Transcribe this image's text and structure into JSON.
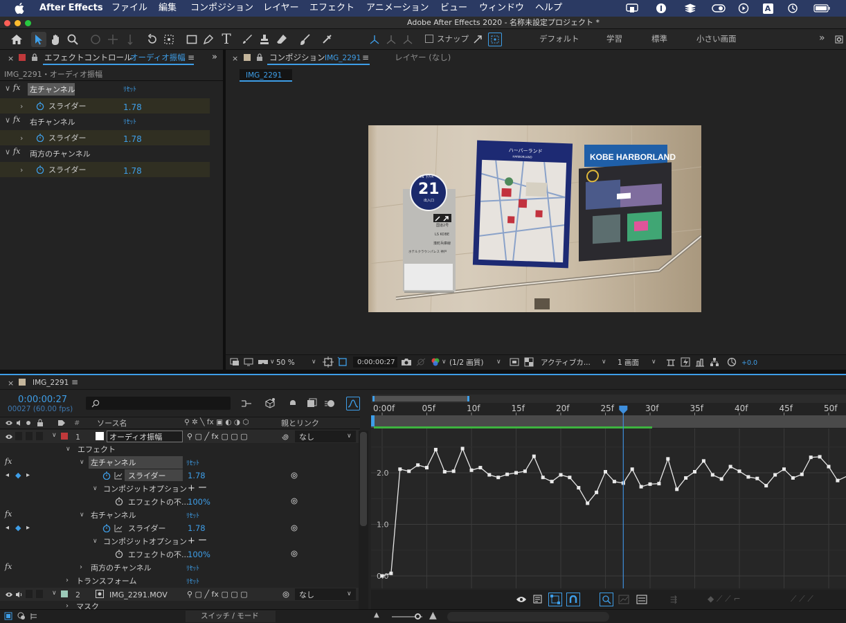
{
  "menubar": {
    "apple": "",
    "app": "After Effects",
    "items": [
      "ファイル",
      "編集",
      "コンポジション",
      "レイヤー",
      "エフェクト",
      "アニメーション",
      "ビュー",
      "ウィンドウ",
      "ヘルプ"
    ],
    "status_letter": "A"
  },
  "window": {
    "title": "Adobe After Effects 2020 - 名称未設定プロジェクト *"
  },
  "toolbar": {
    "snap_label": "スナップ",
    "workspaces": [
      "デフォルト",
      "学習",
      "標準",
      "小さい画面"
    ],
    "more": "»"
  },
  "effects_panel": {
    "tab_label": "エフェクトコントロール",
    "tab_target": "オーディオ振幅",
    "breadcrumb": "IMG_2291・オーディオ振幅",
    "fx": "fx",
    "reset": "ﾘｾｯﾄ",
    "effects": [
      {
        "name": "左チャンネル",
        "param": "スライダー",
        "value": "1.78"
      },
      {
        "name": "右チャンネル",
        "param": "スライダー",
        "value": "1.78"
      },
      {
        "name": "両方のチャンネル",
        "param": "スライダー",
        "value": "1.78"
      }
    ]
  },
  "comp_panel": {
    "tab_label": "コンポジション",
    "tab_target": "IMG_2291",
    "layer_tab": "レイヤー (なし)",
    "subtab": "IMG_2291",
    "viewer": {
      "sign_badge_top": "IN 下ﾁｬｷﾞ",
      "sign_badge_num": "21",
      "sign_badge_sub": "出入口",
      "sign_lines": [
        "国道2号",
        "LS KOBE",
        "湊町兵庫線",
        "ホテルクラウンパレス 神戸"
      ],
      "map_title": "ハーバーランド",
      "map_subtitle": "HARBORLAND",
      "board_title": "KOBE HARBORLAND"
    },
    "bottom": {
      "zoom": "50 %",
      "timecode": "0:00:00:27",
      "resolution": "(1/2 画質)",
      "camera": "アクティブカ...",
      "views": "1 画面",
      "exposure": "+0.0"
    }
  },
  "timeline": {
    "tab": "IMG_2291",
    "timecode": "0:00:00:27",
    "frames": "00027 (60.00 fps)",
    "search_placeholder": "",
    "col_hash": "#",
    "col_source": "ソース名",
    "col_parent": "親とリンク",
    "layers": [
      {
        "index": "1",
        "name": "オーディオ振幅",
        "parent": "なし",
        "label_color": "#c0393b"
      },
      {
        "index": "2",
        "name": "IMG_2291.MOV",
        "parent": "なし",
        "label_color": "#9ccab9"
      }
    ],
    "tree": {
      "effects": "エフェクト",
      "left": "左チャンネル",
      "right": "右チャンネル",
      "both": "両方のチャンネル",
      "transform": "トランスフォーム",
      "mask": "マスク",
      "slider": "スライダー",
      "slider_value": "1.78",
      "composite": "コンポジットオプション",
      "opacity": "エフェクトの不...",
      "opacity_value": "100%",
      "plusminus": "+ ー",
      "reset": "ﾘｾｯﾄ"
    },
    "ruler": [
      "0:00f",
      "05f",
      "10f",
      "15f",
      "20f",
      "25f",
      "30f",
      "35f",
      "40f",
      "45f",
      "50f"
    ],
    "graph_y_labels": [
      "2.0",
      "1.0",
      "0.0"
    ],
    "switch_mode": "スイッチ / モード"
  },
  "chart_data": {
    "type": "line",
    "title": "",
    "xlabel": "",
    "ylabel": "",
    "xlim": [
      0,
      52
    ],
    "ylim": [
      0,
      3
    ],
    "series": [
      {
        "name": "",
        "x": [
          0,
          1,
          2,
          3,
          4,
          5,
          6,
          7,
          8,
          9,
          10,
          11,
          12,
          13,
          14,
          15,
          16,
          17,
          18,
          19,
          20,
          21,
          22,
          23,
          24,
          25,
          26,
          27,
          28,
          29,
          30,
          31,
          32,
          33,
          34,
          35,
          36,
          37,
          38,
          39,
          40,
          41,
          42,
          43,
          44,
          45,
          46,
          47,
          48,
          49,
          50,
          51,
          52
        ],
        "y": [
          0.0,
          0.05,
          2.07,
          2.03,
          2.15,
          2.1,
          2.45,
          2.02,
          2.03,
          2.47,
          2.05,
          2.1,
          1.96,
          1.91,
          1.97,
          2.0,
          2.03,
          2.32,
          1.91,
          1.83,
          1.96,
          1.91,
          1.71,
          1.41,
          1.62,
          2.02,
          1.83,
          1.8,
          2.07,
          1.73,
          1.78,
          1.79,
          2.27,
          1.68,
          1.9,
          2.02,
          2.23,
          1.96,
          1.88,
          2.12,
          2.03,
          1.92,
          1.89,
          1.75,
          1.96,
          2.07,
          1.9,
          1.97,
          2.3,
          2.31,
          2.12,
          1.85,
          1.93
        ]
      }
    ],
    "current_frame": 27
  },
  "colors": {
    "accent": "#3e9ee8",
    "menubar": "#2b3a63",
    "green_bar": "#3db43f"
  }
}
